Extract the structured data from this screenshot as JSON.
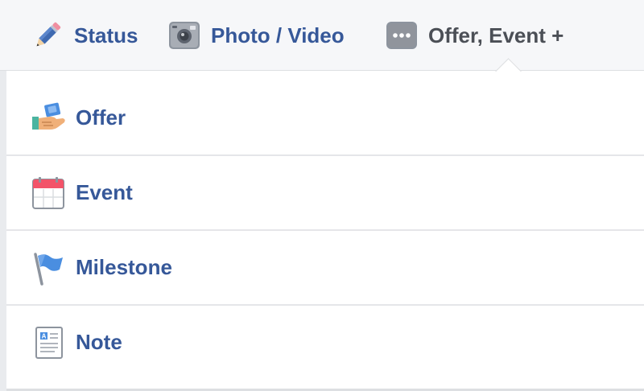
{
  "composer_tabs": {
    "status": {
      "label": "Status",
      "icon": "pencil-icon"
    },
    "photo_video": {
      "label": "Photo / Video",
      "icon": "camera-icon"
    },
    "offer_event": {
      "label": "Offer, Event +",
      "icon": "more-dots-icon",
      "active": true
    }
  },
  "dropdown": {
    "items": [
      {
        "label": "Offer",
        "icon": "offer-hand-icon"
      },
      {
        "label": "Event",
        "icon": "calendar-icon"
      },
      {
        "label": "Milestone",
        "icon": "flag-icon"
      },
      {
        "label": "Note",
        "icon": "note-icon"
      }
    ]
  },
  "colors": {
    "link_blue": "#365899",
    "active_gray": "#4b4f56",
    "bar_bg": "#f6f7f9",
    "divider": "#e5e6e9"
  }
}
